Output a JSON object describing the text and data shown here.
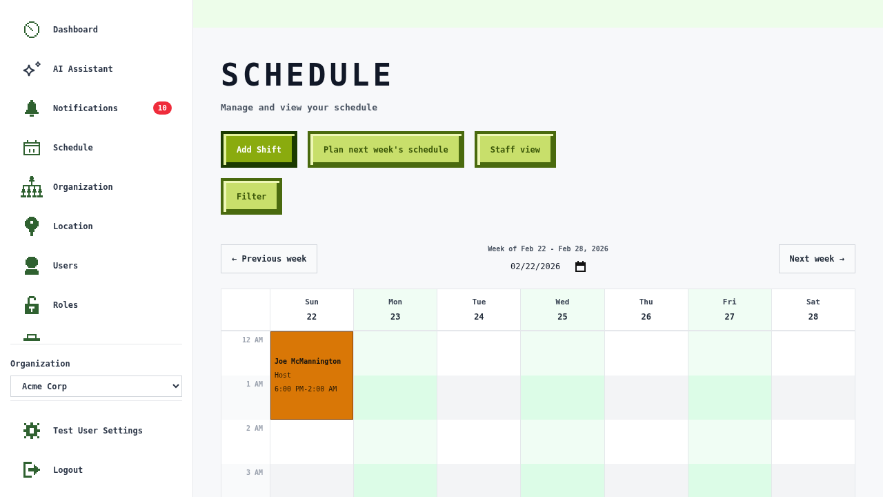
{
  "sidebar": {
    "nav_items": [
      {
        "label": "Dashboard"
      },
      {
        "label": "AI Assistant"
      },
      {
        "label": "Notifications",
        "badge": "10"
      },
      {
        "label": "Schedule"
      },
      {
        "label": "Organization"
      },
      {
        "label": "Location"
      },
      {
        "label": "Users"
      },
      {
        "label": "Roles"
      }
    ],
    "organization": {
      "label": "Organization",
      "value": "Acme Corp"
    },
    "footer_items": [
      {
        "label": "Test User Settings"
      },
      {
        "label": "Logout"
      }
    ]
  },
  "header": {
    "title": "SCHEDULE",
    "subtitle": "Manage and view your schedule"
  },
  "actions": [
    {
      "label": "Add Shift",
      "kind": "primary"
    },
    {
      "label": "Plan next week's schedule",
      "kind": "secondary"
    },
    {
      "label": "Staff view",
      "kind": "secondary"
    },
    {
      "label": "Filter",
      "kind": "secondary"
    }
  ],
  "week_nav": {
    "previous": "← Previous week",
    "range": "Week of Feb 22 - Feb 28, 2026",
    "date": "02/22/2026",
    "next": "Next week →"
  },
  "calendar": {
    "days": [
      {
        "name": "Sun",
        "date": "22",
        "shifts": [
          {
            "name": "Joe McMannington",
            "role": "Host",
            "time": "6:00 PM-2:00 AM"
          }
        ]
      },
      {
        "name": "Mon",
        "date": "23"
      },
      {
        "name": "Tue",
        "date": "24"
      },
      {
        "name": "Wed",
        "date": "25"
      },
      {
        "name": "Thu",
        "date": "26"
      },
      {
        "name": "Fri",
        "date": "27"
      },
      {
        "name": "Sat",
        "date": "28"
      }
    ],
    "hours": [
      "12 AM",
      "1 AM",
      "2 AM",
      "3 AM"
    ]
  }
}
